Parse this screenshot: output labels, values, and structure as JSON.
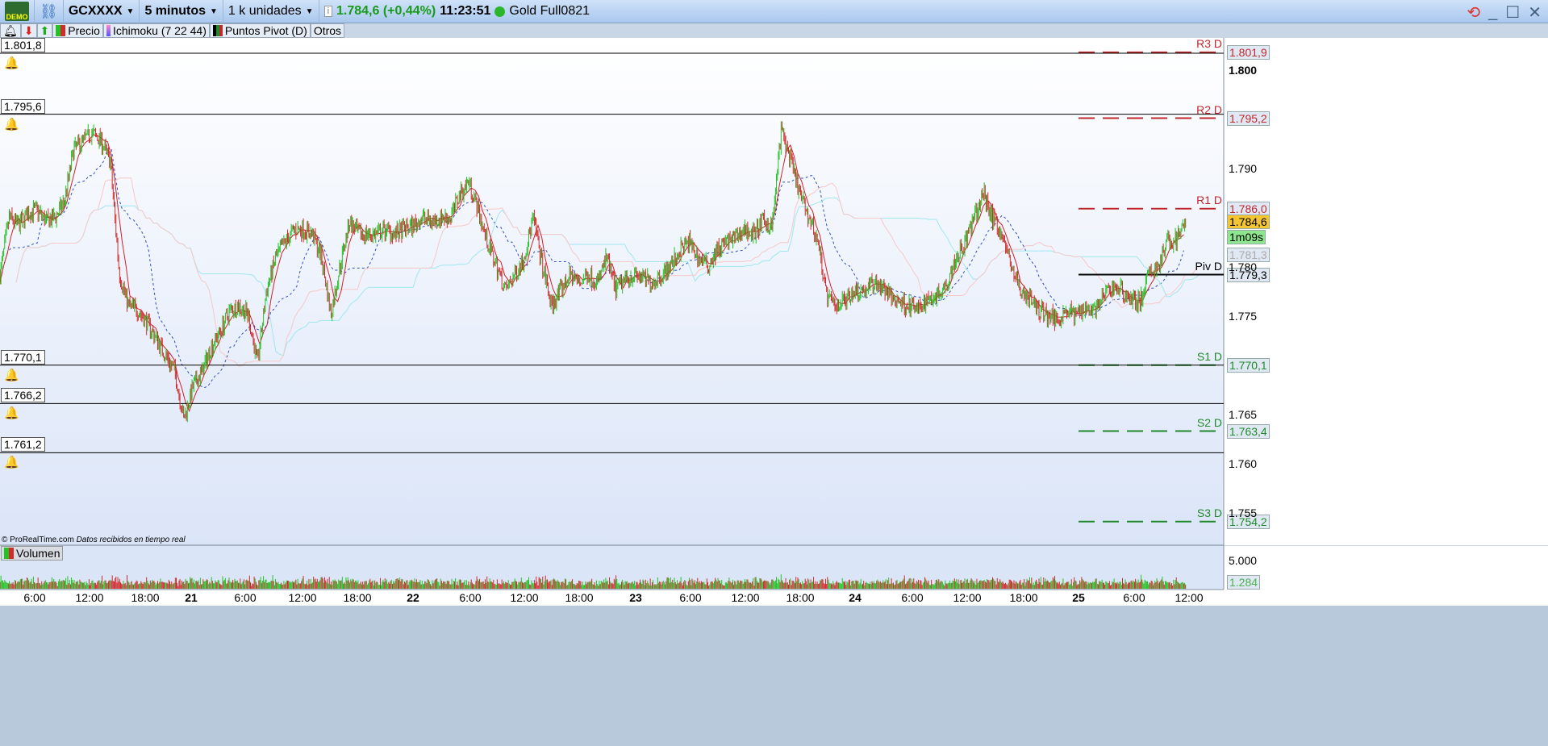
{
  "titlebar": {
    "badge": "DEMO",
    "symbol": "GCXXXX",
    "timeframe": "5 minutos",
    "units": "1 k unidades",
    "price": "1.784,6 (+0,44%)",
    "time": "11:23:51",
    "instrument": "Gold Full0821"
  },
  "toolbar": {
    "items": [
      "Precio",
      "Ichimoku (7 22 44)",
      "Puntos Pivot (D)",
      "Otros"
    ]
  },
  "alerts": [
    "1.801,8",
    "1.795,6",
    "1.770,1",
    "1.766,2",
    "1.761,2"
  ],
  "alert_values": [
    1801.8,
    1795.6,
    1770.1,
    1766.2,
    1761.2
  ],
  "pivots": [
    {
      "name": "R3 D",
      "value": "1.801,9",
      "v": 1801.9,
      "color": "#c0282d"
    },
    {
      "name": "R2 D",
      "value": "1.795,2",
      "v": 1795.2,
      "color": "#c0282d"
    },
    {
      "name": "R1 D",
      "value": "1.786,0",
      "v": 1786.0,
      "color": "#c0282d"
    },
    {
      "name": "Piv D",
      "value": "1.779,3",
      "v": 1779.3,
      "color": "#000000"
    },
    {
      "name": "S1 D",
      "value": "1.770,1",
      "v": 1770.1,
      "color": "#1f8a2a"
    },
    {
      "name": "S2 D",
      "value": "1.763,4",
      "v": 1763.4,
      "color": "#1f8a2a"
    },
    {
      "name": "S3 D",
      "value": "1.754,2",
      "v": 1754.2,
      "color": "#1f8a2a"
    }
  ],
  "price_axis": {
    "ticks": [
      "1.800",
      "1.790",
      "1.780",
      "1.775",
      "1.765",
      "1.760",
      "1.755"
    ],
    "tick_values": [
      1800,
      1790,
      1780,
      1775,
      1765,
      1760,
      1755
    ],
    "last_price": "1.784,6",
    "countdown": "1m09s",
    "ichimoku_value": "1.781,3"
  },
  "footer": {
    "copyright": "© ProRealTime.com",
    "status": "Datos recibidos en tiempo real"
  },
  "volume": {
    "label": "Volumen",
    "axis_tick": "5.000",
    "last": "1.284"
  },
  "x_axis": [
    "6:00",
    "12:00",
    "18:00",
    "21",
    "6:00",
    "12:00",
    "18:00",
    "22",
    "6:00",
    "12:00",
    "18:00",
    "23",
    "6:00",
    "12:00",
    "18:00",
    "24",
    "6:00",
    "12:00",
    "18:00",
    "25",
    "6:00",
    "12:00"
  ],
  "colors": {
    "up": "#22c322",
    "down": "#d22b2b"
  },
  "chart_data": {
    "type": "candlestick",
    "approx_hourly_close": [
      1779.3,
      1785.1,
      1784.3,
      1785.5,
      1785.9,
      1784.7,
      1785.1,
      1786.7,
      1792.0,
      1792.9,
      1793.7,
      1792.9,
      1790.8,
      1779.3,
      1776.1,
      1775.7,
      1774.4,
      1772.8,
      1771.1,
      1769.5,
      1764.6,
      1767.9,
      1769.5,
      1772.0,
      1773.6,
      1775.7,
      1776.1,
      1775.2,
      1770.3,
      1777.7,
      1781.0,
      1782.6,
      1783.9,
      1783.9,
      1783.4,
      1781.0,
      1775.2,
      1780.2,
      1784.7,
      1783.4,
      1783.4,
      1783.4,
      1783.9,
      1783.4,
      1783.9,
      1784.3,
      1785.1,
      1784.7,
      1785.1,
      1785.1,
      1787.5,
      1788.8,
      1785.9,
      1782.6,
      1780.2,
      1777.7,
      1779.3,
      1781.0,
      1785.1,
      1780.2,
      1776.1,
      1777.7,
      1779.3,
      1778.5,
      1779.3,
      1778.5,
      1781.0,
      1777.7,
      1778.9,
      1779.3,
      1778.9,
      1778.5,
      1779.3,
      1780.2,
      1781.8,
      1782.6,
      1781.0,
      1780.2,
      1781.8,
      1782.6,
      1783.0,
      1783.9,
      1783.4,
      1784.7,
      1784.3,
      1794.1,
      1790.8,
      1787.5,
      1785.1,
      1782.6,
      1776.9,
      1776.1,
      1776.9,
      1777.7,
      1777.7,
      1778.5,
      1778.1,
      1776.9,
      1776.5,
      1776.1,
      1775.7,
      1776.9,
      1777.3,
      1778.5,
      1781.0,
      1782.6,
      1785.1,
      1787.5,
      1785.1,
      1783.4,
      1780.2,
      1777.7,
      1776.9,
      1775.7,
      1775.2,
      1774.8,
      1775.7,
      1775.2,
      1776.1,
      1775.7,
      1776.9,
      1778.1,
      1777.7,
      1776.9,
      1776.5,
      1779.3,
      1780.2,
      1782.6,
      1783.0,
      1784.6
    ]
  }
}
